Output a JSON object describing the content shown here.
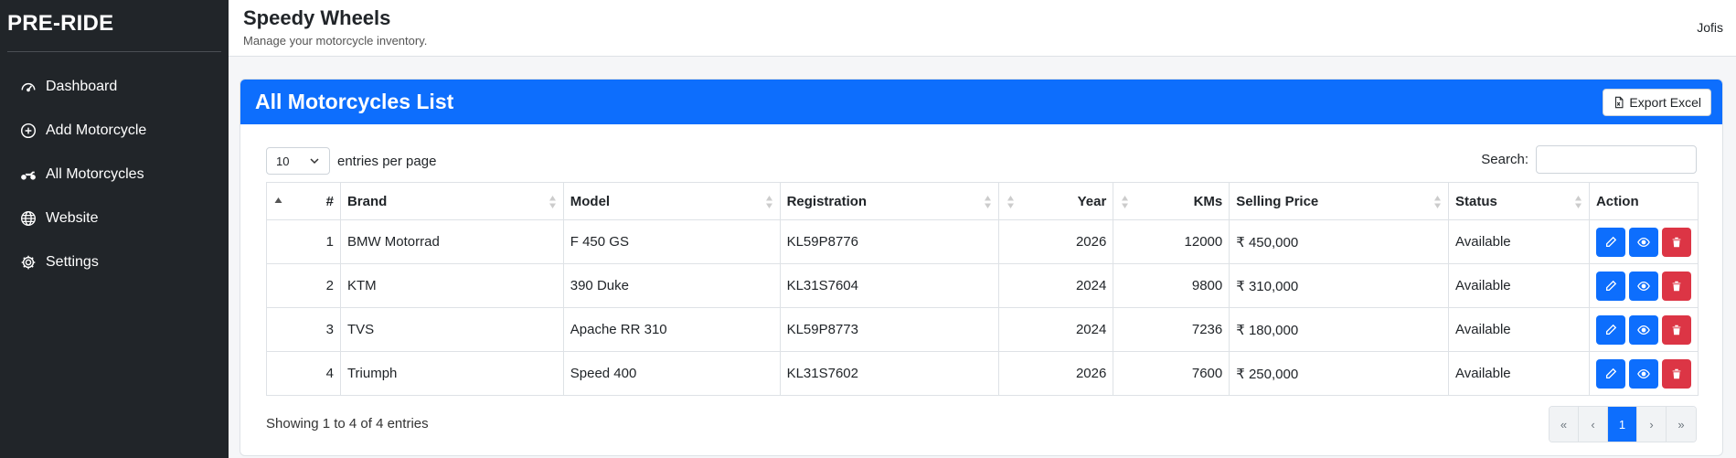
{
  "sidebar": {
    "brand": "PRE-RIDE",
    "items": [
      {
        "label": "Dashboard",
        "icon": "speedometer-icon"
      },
      {
        "label": "Add Motorcycle",
        "icon": "plus-circle-icon"
      },
      {
        "label": "All Motorcycles",
        "icon": "motorcycle-icon"
      },
      {
        "label": "Website",
        "icon": "globe-icon"
      },
      {
        "label": "Settings",
        "icon": "gear-icon"
      }
    ]
  },
  "topbar": {
    "title": "Speedy Wheels",
    "subtitle": "Manage your motorcycle inventory.",
    "user": "Jofis"
  },
  "card": {
    "title": "All Motorcycles List",
    "export_label": "Export Excel",
    "entries_value": "10",
    "entries_label": "entries per page",
    "search_label": "Search:",
    "search_value": ""
  },
  "table": {
    "headers": [
      "#",
      "Brand",
      "Model",
      "Registration",
      "Year",
      "KMs",
      "Selling Price",
      "Status",
      "Action"
    ],
    "rows": [
      {
        "num": "1",
        "brand": "BMW Motorrad",
        "model": "F 450 GS",
        "registration": "KL59P8776",
        "year": "2026",
        "kms": "12000",
        "price": "₹ 450,000",
        "status": "Available"
      },
      {
        "num": "2",
        "brand": "KTM",
        "model": "390 Duke",
        "registration": "KL31S7604",
        "year": "2024",
        "kms": "9800",
        "price": "₹ 310,000",
        "status": "Available"
      },
      {
        "num": "3",
        "brand": "TVS",
        "model": "Apache RR 310",
        "registration": "KL59P8773",
        "year": "2024",
        "kms": "7236",
        "price": "₹ 180,000",
        "status": "Available"
      },
      {
        "num": "4",
        "brand": "Triumph",
        "model": "Speed 400",
        "registration": "KL31S7602",
        "year": "2026",
        "kms": "7600",
        "price": "₹ 250,000",
        "status": "Available"
      }
    ]
  },
  "footer": {
    "info": "Showing 1 to 4 of 4 entries",
    "pagination": [
      "«",
      "‹",
      "1",
      "›",
      "»"
    ],
    "active_page": "1"
  },
  "colors": {
    "primary": "#0d6efd",
    "danger": "#dc3545",
    "sidebar_bg": "#212529"
  }
}
